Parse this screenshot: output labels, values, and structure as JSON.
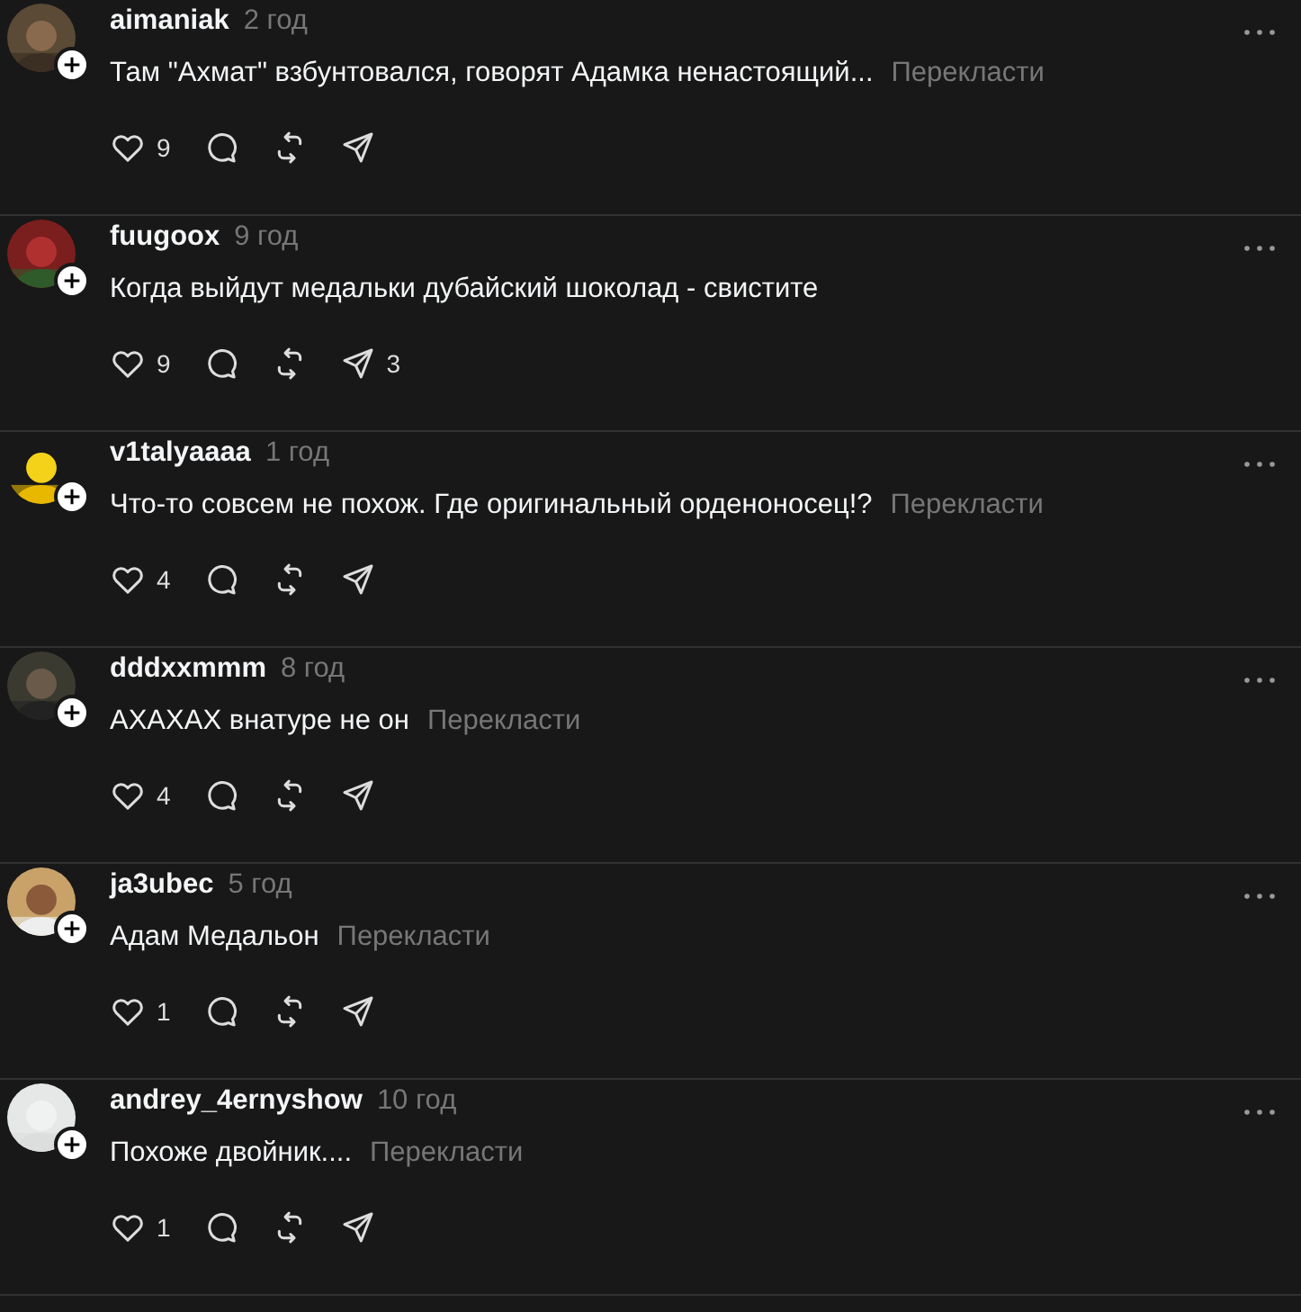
{
  "comments": [
    {
      "username": "aimaniak",
      "time": "2 год",
      "text": "Там \"Ахмат\" взбунтовался, говорят Адамка ненастоящий...",
      "translate": "Перекласти",
      "likes": "9"
    },
    {
      "username": "fuugoox",
      "time": "9 год",
      "text": "Когда выйдут медальки дубайский шоколад - свистите",
      "likes": "9",
      "shares": "3"
    },
    {
      "username": "v1talyaaaa",
      "time": "1 год",
      "text": "Что-то совсем не похож. Где оригинальный орденоносец!?",
      "translate": "Перекласти",
      "likes": "4"
    },
    {
      "username": "dddxxmmm",
      "time": "8 год",
      "text": "АХАХАХ внатуре не он",
      "translate": "Перекласти",
      "likes": "4"
    },
    {
      "username": "ja3ubec",
      "time": "5 год",
      "text": "Адам Медальон",
      "translate": "Перекласти",
      "likes": "1"
    },
    {
      "username": "andrey_4ernyshow",
      "time": "10 год",
      "text": "Похоже двойник....",
      "translate": "Перекласти",
      "likes": "1"
    }
  ]
}
